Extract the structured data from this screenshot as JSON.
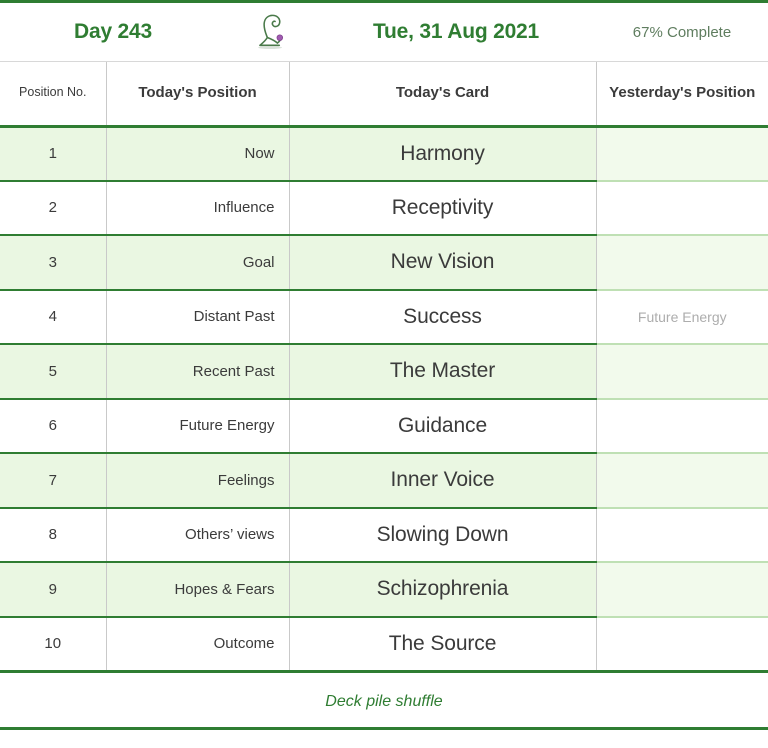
{
  "header": {
    "day_label": "Day 243",
    "date_label": "Tue, 31 Aug 2021",
    "progress_label": "67% Complete",
    "logo_icon": "seated-figure-logo-icon"
  },
  "table": {
    "columns": [
      {
        "key": "position_no",
        "label": "Position No."
      },
      {
        "key": "todays_position",
        "label": "Today's Position"
      },
      {
        "key": "todays_card",
        "label": "Today's Card"
      },
      {
        "key": "yesterdays_position",
        "label": "Yesterday's Position"
      }
    ],
    "rows": [
      {
        "position_no": "1",
        "todays_position": "Now",
        "todays_card": "Harmony",
        "yesterdays_position": ""
      },
      {
        "position_no": "2",
        "todays_position": "Influence",
        "todays_card": "Receptivity",
        "yesterdays_position": ""
      },
      {
        "position_no": "3",
        "todays_position": "Goal",
        "todays_card": "New Vision",
        "yesterdays_position": ""
      },
      {
        "position_no": "4",
        "todays_position": "Distant Past",
        "todays_card": "Success",
        "yesterdays_position": "Future Energy"
      },
      {
        "position_no": "5",
        "todays_position": "Recent Past",
        "todays_card": "The Master",
        "yesterdays_position": ""
      },
      {
        "position_no": "6",
        "todays_position": "Future Energy",
        "todays_card": "Guidance",
        "yesterdays_position": ""
      },
      {
        "position_no": "7",
        "todays_position": "Feelings",
        "todays_card": "Inner Voice",
        "yesterdays_position": ""
      },
      {
        "position_no": "8",
        "todays_position": "Others’ views",
        "todays_card": "Slowing Down",
        "yesterdays_position": ""
      },
      {
        "position_no": "9",
        "todays_position": "Hopes & Fears",
        "todays_card": "Schizophrenia",
        "yesterdays_position": ""
      },
      {
        "position_no": "10",
        "todays_position": "Outcome",
        "todays_card": "The Source",
        "yesterdays_position": ""
      }
    ]
  },
  "footer": {
    "note": "Deck pile shuffle"
  },
  "colors": {
    "accent_green": "#2f7d32",
    "row_tint": "#eaf7e2",
    "row_tint_light": "#f2faec",
    "muted_green": "#5f7d5f",
    "muted_gray": "#adadad",
    "logo_accent": "#a05bb0"
  }
}
